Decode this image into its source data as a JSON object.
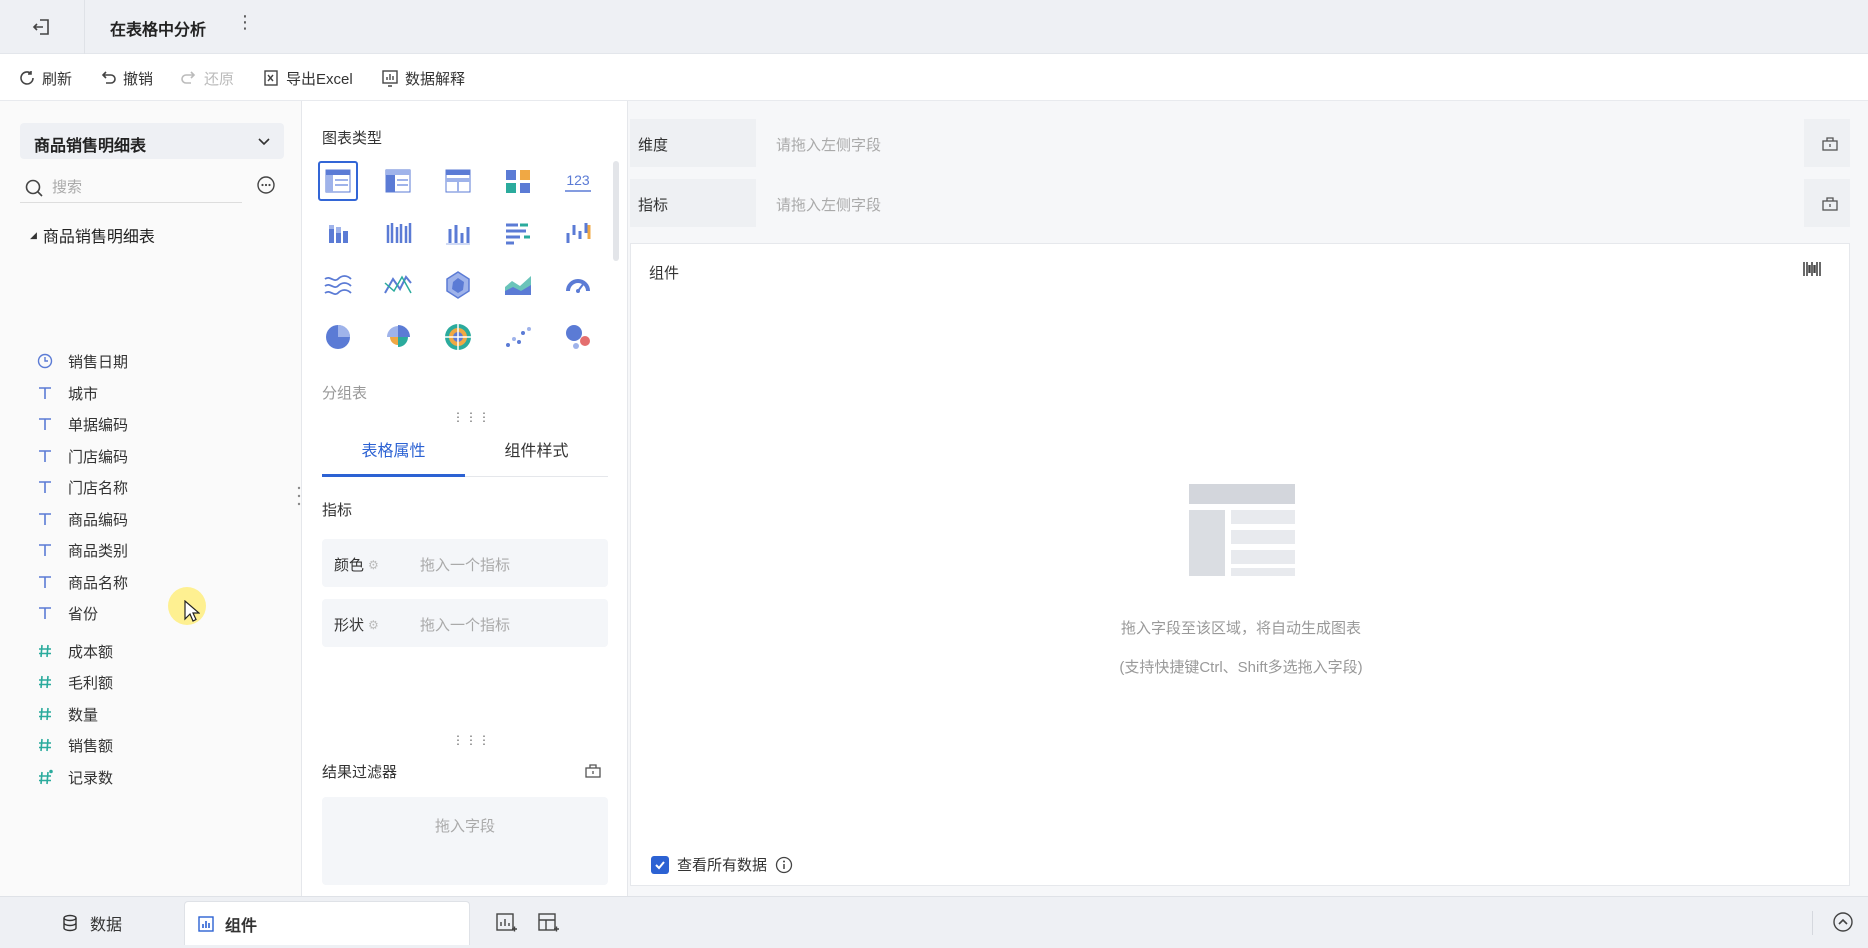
{
  "titlebar": {
    "title": "在表格中分析"
  },
  "toolbar": {
    "refresh": "刷新",
    "undo": "撤销",
    "redo": "还原",
    "export": "导出Excel",
    "explain": "数据解释"
  },
  "left": {
    "dataset": "商品销售明细表",
    "search_placeholder": "搜索",
    "tree_root": "商品销售明细表",
    "fields": [
      {
        "label": "销售日期",
        "type": "date"
      },
      {
        "label": "城市",
        "type": "text"
      },
      {
        "label": "单据编码",
        "type": "text"
      },
      {
        "label": "门店编码",
        "type": "text"
      },
      {
        "label": "门店名称",
        "type": "text"
      },
      {
        "label": "商品编码",
        "type": "text"
      },
      {
        "label": "商品类别",
        "type": "text"
      },
      {
        "label": "商品名称",
        "type": "text"
      },
      {
        "label": "省份",
        "type": "text"
      },
      {
        "label": "成本额",
        "type": "number"
      },
      {
        "label": "毛利额",
        "type": "number"
      },
      {
        "label": "数量",
        "type": "number"
      },
      {
        "label": "销售额",
        "type": "number"
      },
      {
        "label": "记录数",
        "type": "count"
      }
    ]
  },
  "middle": {
    "chart_type_title": "图表类型",
    "chart_types": [
      "group-table-icon",
      "detail-table-icon",
      "cross-table-icon",
      "kpi-card-icon",
      "number-123-icon",
      "stacked-column-icon",
      "multi-column-icon",
      "column-icon",
      "bar-icon",
      "waterfall-icon",
      "stream-icon",
      "line-icon",
      "radar-icon",
      "area-icon",
      "gauge-icon",
      "pie-icon",
      "rose-icon",
      "sunburst-icon",
      "scatter-icon",
      "bubble-icon"
    ],
    "number_icon_text": "123",
    "group_label": "分组表",
    "tabs": [
      "表格属性",
      "组件样式"
    ],
    "section": "指标",
    "slots": [
      {
        "key": "颜色",
        "placeholder": "拖入一个指标"
      },
      {
        "key": "形状",
        "placeholder": "拖入一个指标"
      }
    ],
    "result_filter": "结果过滤器",
    "result_placeholder": "拖入字段"
  },
  "right": {
    "dimension_label": "维度",
    "dimension_placeholder": "请拖入左侧字段",
    "metric_label": "指标",
    "metric_placeholder": "请拖入左侧字段",
    "canvas_title": "组件",
    "empty_line1": "拖入字段至该区域，将自动生成图表",
    "empty_line2": "(支持快捷键Ctrl、Shift多选拖入字段)",
    "view_all": "查看所有数据"
  },
  "bottom": {
    "data_tab": "数据",
    "component_tab": "组件"
  },
  "colors": {
    "accent": "#2c62d3",
    "text_field_icon": "#5b7bd5",
    "number_field_icon": "#2bab9d"
  }
}
